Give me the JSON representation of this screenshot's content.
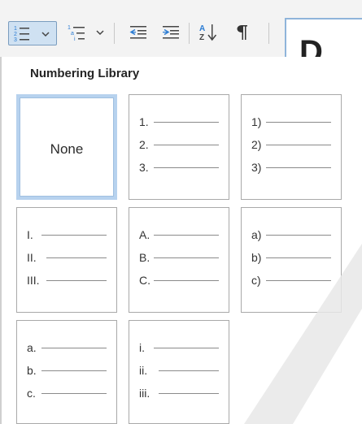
{
  "toolbar": {
    "buttons": [
      {
        "name": "numbering-button",
        "icon": "numbered-list-icon",
        "has_dropdown": true,
        "active": true
      },
      {
        "name": "multilevel-list-button",
        "icon": "multilevel-list-icon",
        "has_dropdown": true
      },
      {
        "name": "decrease-indent-button",
        "icon": "decrease-indent-icon"
      },
      {
        "name": "increase-indent-button",
        "icon": "increase-indent-icon"
      },
      {
        "name": "sort-button",
        "icon": "sort-az-icon"
      },
      {
        "name": "show-formatting-button",
        "icon": "pilcrow-icon"
      }
    ],
    "preview_letter": "D"
  },
  "panel": {
    "title": "Numbering Library",
    "none_label": "None",
    "formats": [
      {
        "markers": [
          "1.",
          "2.",
          "3."
        ]
      },
      {
        "markers": [
          "1)",
          "2)",
          "3)"
        ]
      },
      {
        "markers": [
          "I.",
          "II.",
          "III."
        ]
      },
      {
        "markers": [
          "A.",
          "B.",
          "C."
        ]
      },
      {
        "markers": [
          "a)",
          "b)",
          "c)"
        ]
      },
      {
        "markers": [
          "a.",
          "b.",
          "c."
        ]
      },
      {
        "markers": [
          "i.",
          "ii.",
          "iii."
        ]
      }
    ]
  },
  "colors": {
    "accent": "#2b7cd3",
    "selected_border": "#b7d2ee",
    "watermark": "#e8e8e8"
  }
}
